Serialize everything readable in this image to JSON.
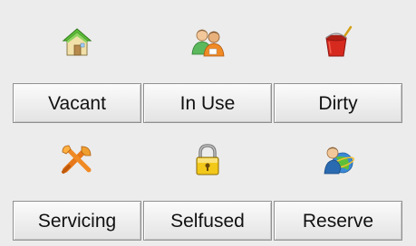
{
  "statuses": {
    "row1": [
      {
        "label": "Vacant",
        "icon": "house-icon"
      },
      {
        "label": "In Use",
        "icon": "people-icon"
      },
      {
        "label": "Dirty",
        "icon": "bucket-broom-icon"
      }
    ],
    "row2": [
      {
        "label": "Servicing",
        "icon": "tools-icon"
      },
      {
        "label": "Selfused",
        "icon": "padlock-icon"
      },
      {
        "label": "Reserve",
        "icon": "user-globe-icon"
      }
    ]
  },
  "colors": {
    "background": "#ececec",
    "button_border": "#8f8f8f",
    "text": "#111111"
  }
}
